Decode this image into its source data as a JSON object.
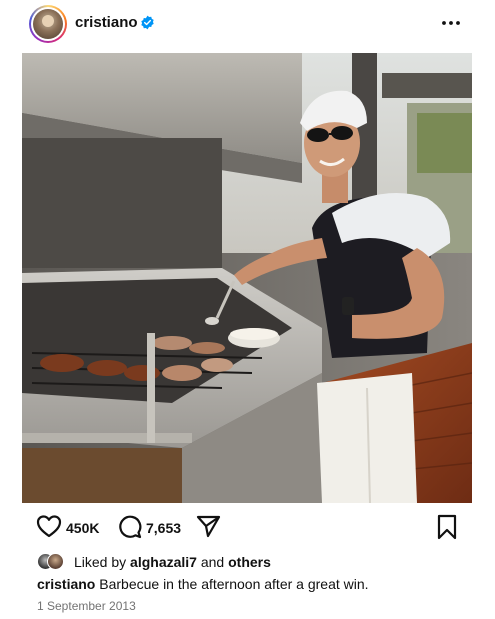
{
  "post": {
    "username": "cristiano",
    "verified": true,
    "image_alt": "cristiano-barbecue-photo",
    "likes": "450K",
    "comments": "7,653",
    "liked_by_prefix": "Liked by",
    "liked_by_user": "alghazali7",
    "liked_by_join": "and",
    "liked_by_others": "others",
    "caption_user": "cristiano",
    "caption_text": "Barbecue in the afternoon after a great win.",
    "date": "1 September 2013"
  },
  "icons": {
    "verified": "verified-badge-icon",
    "more": "more-options-icon",
    "like": "heart-icon",
    "comment": "comment-icon",
    "share": "paper-plane-icon",
    "save": "bookmark-icon"
  },
  "colors": {
    "verified_blue": "#0095f6",
    "text": "#111111",
    "muted": "#737373"
  }
}
